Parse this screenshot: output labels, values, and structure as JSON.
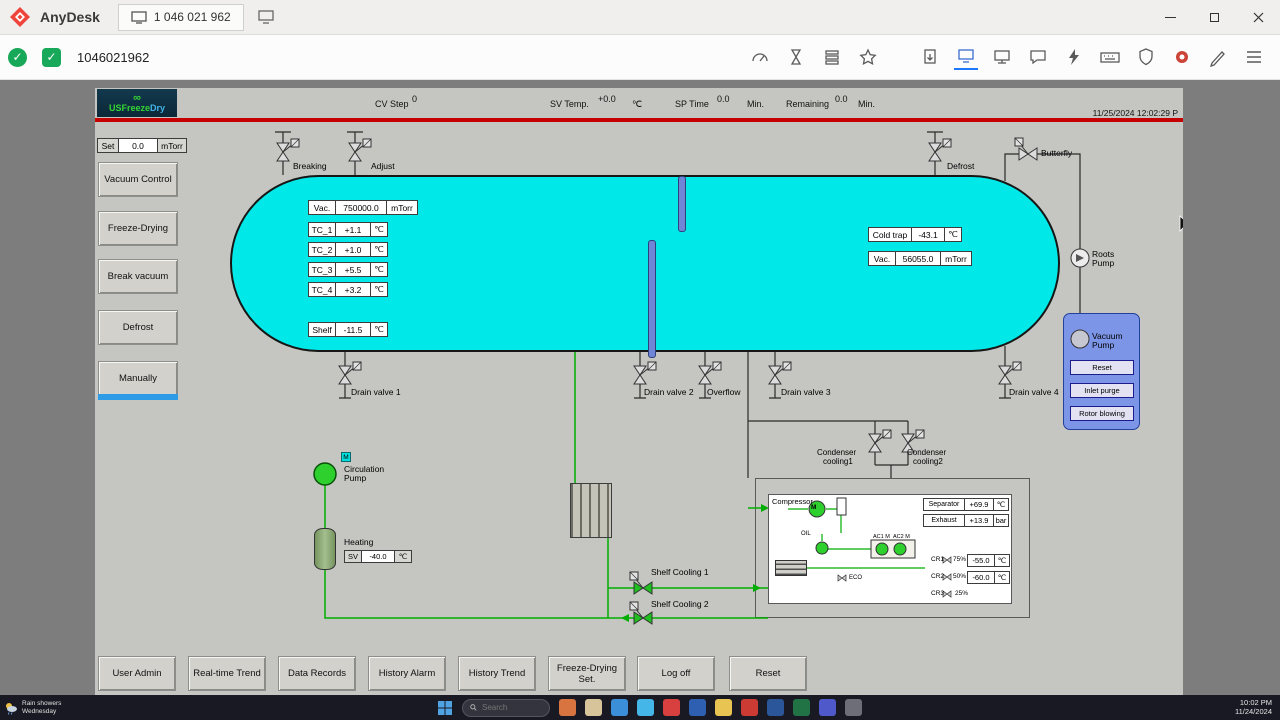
{
  "colors": {
    "accent_red": "#c40000",
    "tank_cyan": "#00e8e8",
    "panel_blue": "#7d95e6",
    "pipe_green": "#00ad00",
    "active_tab_blue": "#2e9be6",
    "anydesk_red": "#ef443b",
    "status_green": "#17a85a"
  },
  "anydesk": {
    "app_name": "AnyDesk",
    "session_tab": "1 046 021 962",
    "session_id": "1046021962"
  },
  "app": {
    "logo": {
      "part1": "USFreeze",
      "part2": "Dry",
      "swirl": "∞"
    },
    "header": {
      "cv_step": {
        "label": "CV Step",
        "value": "0"
      },
      "sv_temp": {
        "label": "SV Temp.",
        "value": "+0.0",
        "unit": "℃"
      },
      "sp_time": {
        "label": "SP Time",
        "value": "0.0",
        "unit": "Min."
      },
      "remaining": {
        "label": "Remaining",
        "value": "0.0",
        "unit": "Min."
      },
      "timestamp": "11/25/2024 12:02:29 P"
    },
    "sidebar": {
      "set_field": {
        "label": "Set",
        "value": "0.0",
        "unit": "mTorr"
      },
      "buttons": [
        {
          "label": "Vacuum Control"
        },
        {
          "label": "Freeze-Drying"
        },
        {
          "label": "Break vacuum"
        },
        {
          "label": "Defrost"
        },
        {
          "label": "Manually"
        }
      ]
    },
    "tank": {
      "vac": {
        "label": "Vac.",
        "value": "750000.0",
        "unit": "mTorr"
      },
      "tc1": {
        "label": "TC_1",
        "value": "+1.1",
        "unit": "℃"
      },
      "tc2": {
        "label": "TC_2",
        "value": "+1.0",
        "unit": "℃"
      },
      "tc3": {
        "label": "TC_3",
        "value": "+5.5",
        "unit": "℃"
      },
      "tc4": {
        "label": "TC_4",
        "value": "+3.2",
        "unit": "℃"
      },
      "shelf": {
        "label": "Shelf",
        "value": "-11.5",
        "unit": "℃"
      },
      "cold_trap": {
        "label": "Cold trap",
        "value": "-43.1",
        "unit": "℃"
      },
      "vac2": {
        "label": "Vac.",
        "value": "56055.0",
        "unit": "mTorr"
      }
    },
    "valves": {
      "breaking": "Breaking",
      "adjust": "Adjust",
      "defrost": "Defrost",
      "butterfly": "Butterfly",
      "drain1": "Drain valve 1",
      "drain2": "Drain valve 2",
      "overflow": "Overflow",
      "drain3": "Drain valve 3",
      "drain4": "Drain valve 4",
      "condenser1": [
        "Condenser",
        "cooling1"
      ],
      "condenser2": [
        "Condenser",
        "cooling2"
      ],
      "shelf_cooling1": "Shelf Cooling 1",
      "shelf_cooling2": "Shelf Cooling 2"
    },
    "pumps": {
      "roots": [
        "Roots",
        "Pump"
      ],
      "vacuum": [
        "Vacuum",
        "Pump"
      ],
      "circulation": [
        "Circulation",
        "Pump"
      ],
      "motor_label": "M"
    },
    "vacuum_panel": {
      "buttons": [
        "Reset",
        "Inlet purge",
        "Rotor blowing"
      ]
    },
    "heating": {
      "label": "Heating",
      "sv": {
        "label": "SV",
        "value": "-40.0",
        "unit": "℃"
      }
    },
    "compressor": {
      "title": "Compressor",
      "separator": {
        "label": "Separator",
        "value": "+69.9",
        "unit": "℃"
      },
      "exhaust": {
        "label": "Exhaust",
        "value": "+13.9",
        "unit": "bar"
      },
      "oil": "OIL",
      "eco": "ECO",
      "ac1": "AC1 M",
      "ac2": "AC2 M",
      "cr": [
        {
          "name": "CR1",
          "percent": "75%",
          "value": "-55.0",
          "unit": "℃"
        },
        {
          "name": "CR2",
          "percent": "50%",
          "value": "-60.0",
          "unit": "℃"
        },
        {
          "name": "CR3",
          "percent": "25%"
        }
      ]
    },
    "bottom_buttons": [
      "User Admin",
      "Real-time Trend",
      "Data Records",
      "History Alarm",
      "History Trend",
      "Freeze-Drying Set.",
      "Log off",
      "Reset"
    ]
  },
  "taskbar": {
    "weather": [
      "Rain showers",
      "Wednesday"
    ],
    "search": "Search",
    "clock": {
      "time": "10:02 PM",
      "date": "11/24/2024"
    },
    "icons": [
      {
        "name": "contacts-icon",
        "color": "#d8743f"
      },
      {
        "name": "notes-icon",
        "color": "#d8c49a"
      },
      {
        "name": "edge-icon",
        "color": "#3b8fd8"
      },
      {
        "name": "skype-icon",
        "color": "#45b6e8"
      },
      {
        "name": "opera-icon",
        "color": "#d84040"
      },
      {
        "name": "mail-icon",
        "color": "#2f5fb0"
      },
      {
        "name": "file-explorer-icon",
        "color": "#e8c552"
      },
      {
        "name": "adobe-icon",
        "color": "#cc3b33"
      },
      {
        "name": "word-icon",
        "color": "#2b579a"
      },
      {
        "name": "excel-icon",
        "color": "#217346"
      },
      {
        "name": "teams-icon",
        "color": "#5059c9"
      },
      {
        "name": "settings-icon",
        "color": "#6e6e78"
      }
    ]
  }
}
